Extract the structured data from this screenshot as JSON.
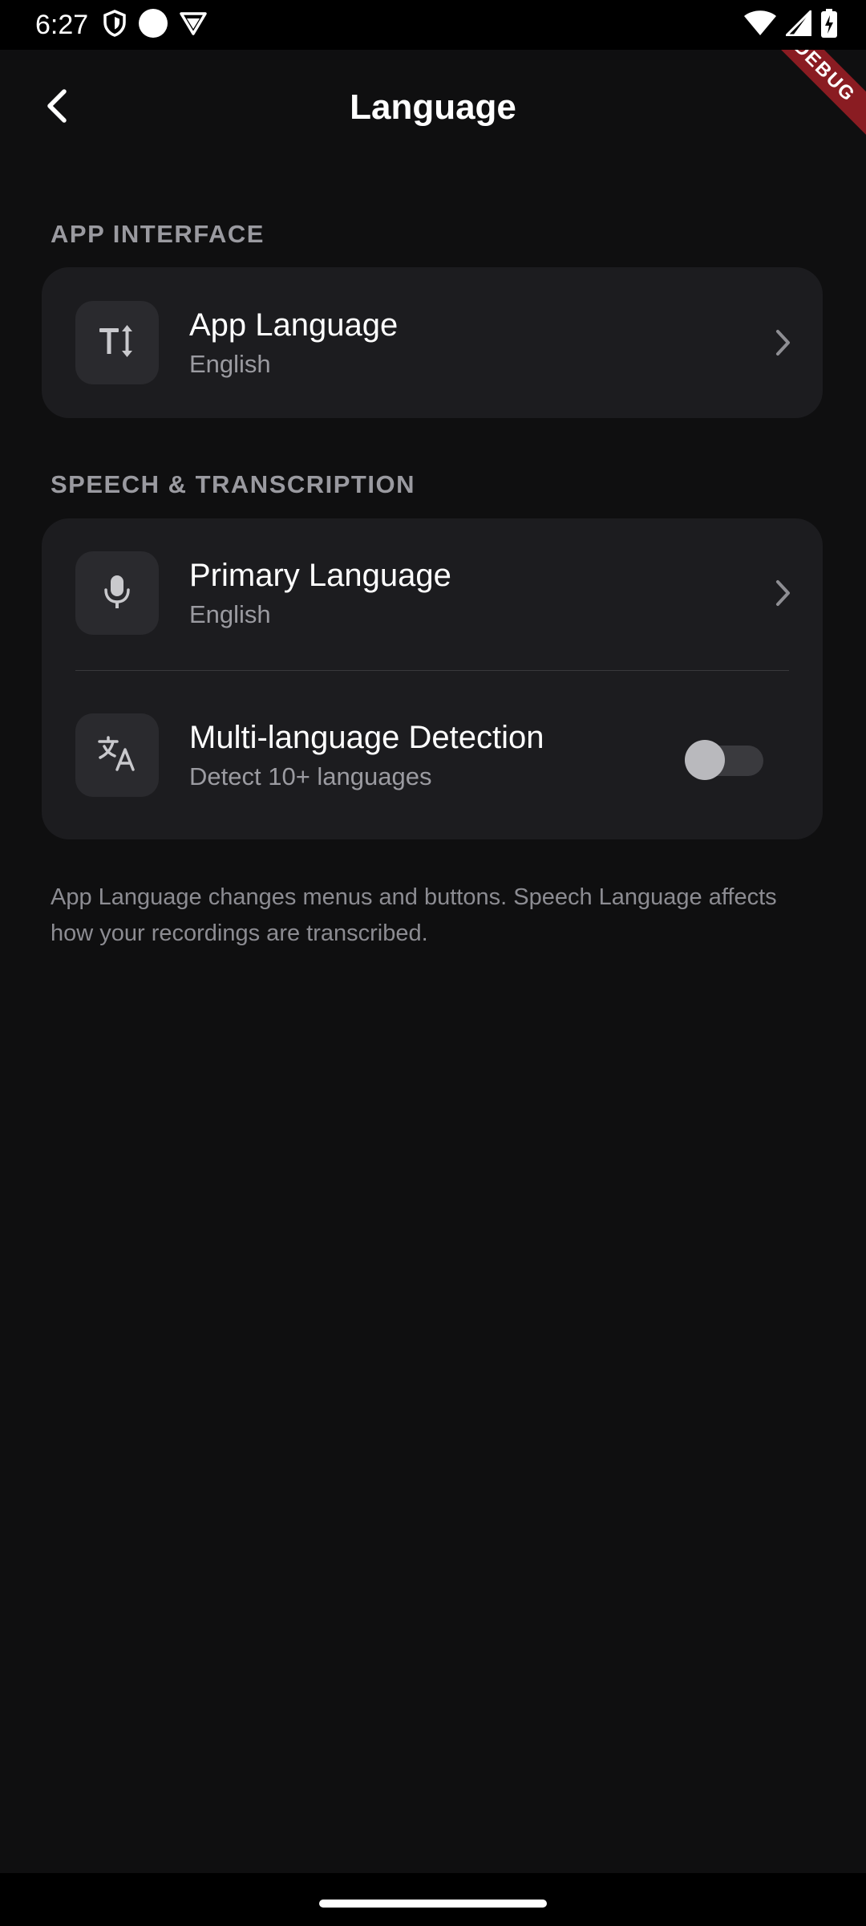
{
  "status_bar": {
    "time": "6:27",
    "left_icons": [
      "shield-icon",
      "circle-icon",
      "vpn-icon"
    ],
    "right_icons": [
      "wifi-icon",
      "signal-icon",
      "battery-charging-icon"
    ]
  },
  "debug_banner": "DEBUG",
  "header": {
    "back_icon": "chevron-left-icon",
    "title": "Language"
  },
  "sections": [
    {
      "header": "APP INTERFACE",
      "items": [
        {
          "icon": "text-size-icon",
          "title": "App Language",
          "subtitle": "English",
          "control": "chevron-right-icon"
        }
      ]
    },
    {
      "header": "SPEECH & TRANSCRIPTION",
      "items": [
        {
          "icon": "microphone-icon",
          "title": "Primary Language",
          "subtitle": "English",
          "control": "chevron-right-icon"
        },
        {
          "icon": "translate-icon",
          "title": "Multi-language Detection",
          "subtitle": "Detect 10+ languages",
          "control": "toggle",
          "toggle_on": false
        }
      ]
    }
  ],
  "footnote": "App Language changes menus and buttons. Speech Language affects how your recordings are transcribed.",
  "colors": {
    "background": "#0f0f10",
    "card": "#1c1c1f",
    "icon_box": "#2a2a2e",
    "section_header": "#9a9aa0",
    "subtitle": "#9b9ba1",
    "debug_banner": "#8a1c22"
  }
}
